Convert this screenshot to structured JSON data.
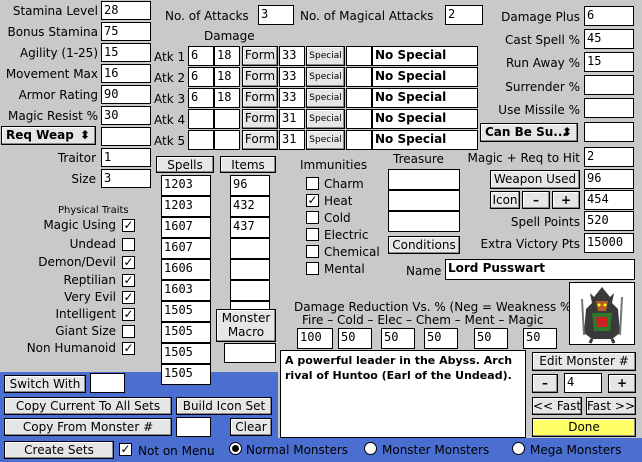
{
  "stats": [
    {
      "label": "Stamina Level",
      "value": "28"
    },
    {
      "label": "Bonus Stamina",
      "value": "75"
    },
    {
      "label": "Agility (1-25)",
      "value": "15"
    },
    {
      "label": "Movement Max",
      "value": "16"
    },
    {
      "label": "Armor Rating",
      "value": "90"
    },
    {
      "label": "Magic Resist %",
      "value": "30"
    }
  ],
  "req_weap": "Req Weap",
  "req_weap_value": "",
  "traitor": {
    "label": "Traitor",
    "value": "1"
  },
  "size": {
    "label": "Size",
    "value": "3"
  },
  "attacks": {
    "label": "No. of Attacks",
    "value": "3"
  },
  "magical_attacks": {
    "label": "No. of Magical Attacks",
    "value": "2"
  },
  "damage_header": "Damage",
  "atk_rows": [
    {
      "label": "Atk 1",
      "d1": "6",
      "d2": "18",
      "form": "Form",
      "fv": "33",
      "special": "Special",
      "sv": "",
      "text": "No Special"
    },
    {
      "label": "Atk 2",
      "d1": "6",
      "d2": "18",
      "form": "Form",
      "fv": "33",
      "special": "Special",
      "sv": "",
      "text": "No Special"
    },
    {
      "label": "Atk 3",
      "d1": "6",
      "d2": "18",
      "form": "Form",
      "fv": "33",
      "special": "Special",
      "sv": "",
      "text": "No Special"
    },
    {
      "label": "Atk 4",
      "d1": "",
      "d2": "",
      "form": "Form",
      "fv": "31",
      "special": "Special",
      "sv": "",
      "text": "No Special"
    },
    {
      "label": "Atk 5",
      "d1": "",
      "d2": "",
      "form": "Form",
      "fv": "31",
      "special": "Special",
      "sv": "",
      "text": "No Special"
    }
  ],
  "right": {
    "damage_plus": {
      "label": "Damage Plus",
      "value": "6"
    },
    "cast_spell": {
      "label": "Cast Spell %",
      "value": "45"
    },
    "run_away": {
      "label": "Run Away %",
      "value": "15"
    },
    "surrender": {
      "label": "Surrender %",
      "value": ""
    },
    "use_missile": {
      "label": "Use Missile %",
      "value": ""
    },
    "can_be": "Can Be Su...",
    "can_be_value": "",
    "magic_req": {
      "label": "Magic + Req to Hit",
      "value": "2"
    },
    "weapon_used": {
      "label": "Weapon Used",
      "value": "96"
    },
    "icon": {
      "label": "Icon",
      "minus": "–",
      "plus": "+",
      "value": "454"
    },
    "spell_points": {
      "label": "Spell Points",
      "value": "520"
    },
    "victory": {
      "label": "Extra Victory Pts",
      "value": "15000"
    }
  },
  "spells_label": "Spells",
  "items_label": "Items",
  "spells": [
    "1203",
    "1203",
    "1607",
    "1607",
    "1606",
    "1603",
    "1505",
    "1505",
    "1505",
    "1505"
  ],
  "items": [
    "96",
    "432",
    "437",
    "",
    "",
    "",
    "",
    ""
  ],
  "immunities": {
    "title": "Immunities",
    "list": [
      {
        "label": "Charm",
        "checked": ""
      },
      {
        "label": "Heat",
        "checked": "✓"
      },
      {
        "label": "Cold",
        "checked": ""
      },
      {
        "label": "Electric",
        "checked": ""
      },
      {
        "label": "Chemical",
        "checked": ""
      },
      {
        "label": "Mental",
        "checked": ""
      }
    ]
  },
  "treasure": {
    "title": "Treasure",
    "values": [
      "",
      "",
      ""
    ],
    "conditions": "Conditions"
  },
  "name": {
    "label": "Name",
    "value": "Lord Pusswart"
  },
  "physical_traits": {
    "title": "Physical Traits",
    "list": [
      {
        "label": "Magic Using",
        "checked": "✓"
      },
      {
        "label": "Undead",
        "checked": ""
      },
      {
        "label": "Demon/Devil",
        "checked": "✓"
      },
      {
        "label": "Reptilian",
        "checked": "✓"
      },
      {
        "label": "Very Evil",
        "checked": "✓"
      },
      {
        "label": "Intelligent",
        "checked": "✓"
      },
      {
        "label": "Giant Size",
        "checked": ""
      },
      {
        "label": "Non Humanoid",
        "checked": "✓"
      }
    ]
  },
  "monster_macro": {
    "label": "Monster Macro",
    "value": ""
  },
  "damage_reduction": {
    "title": "Damage Reduction Vs. % (Neg = Weakness %)",
    "sub": "Fire – Cold – Elec – Chem – Ment – Magic",
    "values": [
      "100",
      "50",
      "50",
      "50",
      "50",
      "50"
    ]
  },
  "description": "A powerful leader in the Abyss.  Arch rival of Huntoo (Earl of the Undead).",
  "edit_monster": {
    "label": "Edit Monster #",
    "minus": "–",
    "value": "4",
    "plus": "+",
    "fast_back": "<< Fast",
    "fast_fwd": "Fast >>",
    "done": "Done"
  },
  "bottom": {
    "switch_with": "Switch With",
    "switch_value": "",
    "copy_all": "Copy Current To All Sets",
    "build_icon": "Build Icon Set",
    "copy_from": "Copy From Monster #",
    "copy_value": "",
    "clear": "Clear",
    "create_sets": "Create Sets",
    "not_on_menu": "Not on Menu",
    "not_on_menu_checked": "✓",
    "normal": "Normal Monsters",
    "monster": "Monster Monsters",
    "mega": "Mega Monsters"
  },
  "colors": {
    "blue": "#4a6fd0",
    "yellow": "#ffff66",
    "panel": "#c9c9c9"
  }
}
